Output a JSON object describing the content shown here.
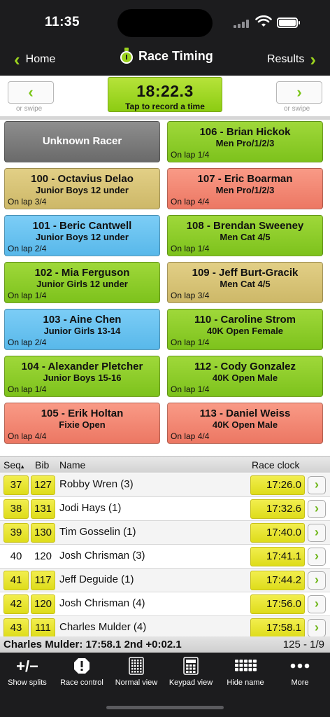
{
  "status": {
    "time": "11:35"
  },
  "nav": {
    "back_label": "Home",
    "title": "Race Timing",
    "results_label": "Results"
  },
  "clock": {
    "time": "18:22.3",
    "subtitle": "Tap to record a time",
    "swipe_hint": "or swipe"
  },
  "racers": [
    {
      "name": "Unknown Racer",
      "class": "",
      "lap": "",
      "color": "gray"
    },
    {
      "name": "106 - Brian Hickok",
      "class": "Men Pro/1/2/3",
      "lap": "On lap 1/4",
      "color": "green"
    },
    {
      "name": "100 - Octavius Delao",
      "class": "Junior Boys 12 under",
      "lap": "On lap 3/4",
      "color": "gold"
    },
    {
      "name": "107 - Eric Boarman",
      "class": "Men Pro/1/2/3",
      "lap": "On lap 4/4",
      "color": "salmon"
    },
    {
      "name": "101 - Beric Cantwell",
      "class": "Junior Boys 12 under",
      "lap": "On lap 2/4",
      "color": "blue"
    },
    {
      "name": "108 - Brendan Sweeney",
      "class": "Men Cat 4/5",
      "lap": "On lap 1/4",
      "color": "green"
    },
    {
      "name": "102 - Mia Ferguson",
      "class": "Junior Girls 12 under",
      "lap": "On lap 1/4",
      "color": "green"
    },
    {
      "name": "109 - Jeff Burt-Gracik",
      "class": "Men Cat 4/5",
      "lap": "On lap 3/4",
      "color": "gold"
    },
    {
      "name": "103 - Aine Chen",
      "class": "Junior Girls 13-14",
      "lap": "On lap 2/4",
      "color": "blue"
    },
    {
      "name": "110 - Caroline Strom",
      "class": "40K Open Female",
      "lap": "On lap 1/4",
      "color": "green"
    },
    {
      "name": "104 - Alexander Pletcher",
      "class": "Junior Boys 15-16",
      "lap": "On lap 1/4",
      "color": "green"
    },
    {
      "name": "112 - Cody Gonzalez",
      "class": "40K Open Male",
      "lap": "On lap 1/4",
      "color": "green"
    },
    {
      "name": "105 - Erik Holtan",
      "class": "Fixie Open",
      "lap": "On lap 4/4",
      "color": "salmon"
    },
    {
      "name": "113 - Daniel Weiss",
      "class": "40K Open Male",
      "lap": "On lap 4/4",
      "color": "salmon"
    }
  ],
  "table": {
    "headers": {
      "seq": "Seq",
      "sort_marker": "▴",
      "bib": "Bib",
      "name": "Name",
      "clock": "Race clock"
    },
    "rows": [
      {
        "seq": "37",
        "bib": "127",
        "name": "Robby Wren (3)",
        "clock": "17:26.0",
        "highlight": true
      },
      {
        "seq": "38",
        "bib": "131",
        "name": "Jodi Hays (1)",
        "clock": "17:32.6",
        "highlight": true
      },
      {
        "seq": "39",
        "bib": "130",
        "name": "Tim Gosselin (1)",
        "clock": "17:40.0",
        "highlight": true
      },
      {
        "seq": "40",
        "bib": "120",
        "name": "Josh Chrisman (3)",
        "clock": "17:41.1",
        "highlight": false
      },
      {
        "seq": "41",
        "bib": "117",
        "name": "Jeff Deguide (1)",
        "clock": "17:44.2",
        "highlight": true
      },
      {
        "seq": "42",
        "bib": "120",
        "name": "Josh Chrisman (4)",
        "clock": "17:56.0",
        "highlight": true
      },
      {
        "seq": "43",
        "bib": "111",
        "name": "Charles Mulder (4)",
        "clock": "17:58.1",
        "highlight": true
      }
    ]
  },
  "summary": {
    "left": "Charles Mulder: 17:58.1 2nd +0:02.1",
    "right": "125 - 1/9"
  },
  "toolbar": [
    {
      "label": "Show splits",
      "icon": "plus-minus-icon"
    },
    {
      "label": "Race control",
      "icon": "alert-octagon-icon"
    },
    {
      "label": "Normal view",
      "icon": "grid-view-icon"
    },
    {
      "label": "Keypad view",
      "icon": "calculator-icon"
    },
    {
      "label": "Hide name",
      "icon": "keyboard-icon"
    },
    {
      "label": "More",
      "icon": "more-dots-icon"
    }
  ],
  "colors": {
    "accent": "#9bd21f",
    "green": "#8ccc22",
    "gold": "#d8c477",
    "salmon": "#f3866f",
    "blue": "#69c2f0",
    "yellow": "#ebe53a"
  }
}
